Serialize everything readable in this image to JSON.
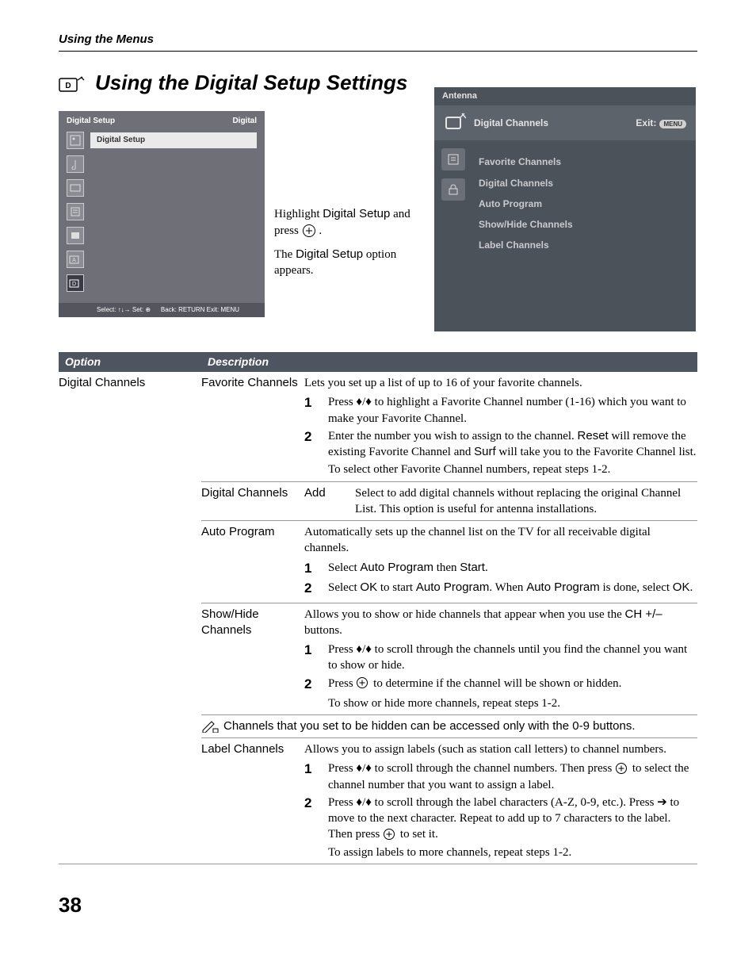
{
  "section_header": "Using the Menus",
  "page_title": "Using the Digital Setup Settings",
  "setup_osd": {
    "title_left": "Digital Setup",
    "title_right": "Digital",
    "highlighted_row": "Digital Setup",
    "footer_left": "Select: ↑↓→  Set: ⊕",
    "footer_right": "Back: RETURN  Exit: MENU"
  },
  "middle_instruction": {
    "p1_a": "Highlight ",
    "p1_b": "Digital Setup",
    "p1_c": " and press ",
    "p1_d": " .",
    "p2_a": "The ",
    "p2_b": "Digital Setup",
    "p2_c": " option appears."
  },
  "antenna_osd": {
    "header": "Antenna",
    "title": "Digital Channels",
    "exit_label": "Exit:",
    "exit_badge": "MENU",
    "items": [
      "Favorite Channels",
      "Digital Channels",
      "Auto Program",
      "Show/Hide Channels",
      "Label Channels"
    ]
  },
  "table_header": {
    "c1": "Option",
    "c2": "Description"
  },
  "option_name": "Digital Channels",
  "favorite": {
    "title": "Favorite Channels",
    "intro": "Lets you set up a list of up to 16 of your favorite channels.",
    "s1": "Press ♦/♦ to highlight a Favorite Channel number (1-16) which you want to make your Favorite Channel.",
    "s2_a": "Enter the number you wish to assign to the channel. ",
    "s2_b": "Reset",
    "s2_c": " will remove the existing Favorite Channel and ",
    "s2_d": "Surf",
    "s2_e": " will take you to the Favorite Channel list.",
    "s_after": "To select other Favorite Channel numbers, repeat steps 1-2."
  },
  "digital": {
    "title": "Digital Channels",
    "add_label": "Add",
    "add_desc": "Select to add digital channels without replacing the original Channel List. This option is useful for antenna installations."
  },
  "auto": {
    "title": "Auto Program",
    "intro": "Automatically sets up the channel list on the TV for all receivable digital channels.",
    "s1_a": "Select ",
    "s1_b": "Auto Program",
    "s1_c": " then ",
    "s1_d": "Start",
    "s1_e": ".",
    "s2_a": "Select ",
    "s2_b": "OK",
    "s2_c": " to start ",
    "s2_d": "Auto Program",
    "s2_e": ". When ",
    "s2_f": "Auto Program",
    "s2_g": " is done, select ",
    "s2_h": "OK",
    "s2_i": "."
  },
  "showhide": {
    "title": "Show/Hide Channels",
    "intro_a": "Allows you to show or hide channels that appear when you use the ",
    "intro_b": "CH +/–",
    "intro_c": " buttons.",
    "s1": "Press ♦/♦ to scroll through the channels until you find the channel you want to show or hide.",
    "s2_a": "Press ",
    "s2_b": " to determine if the channel will be shown or hidden.",
    "after": "To show or hide more channels, repeat steps 1-2."
  },
  "note": "Channels that you set to be hidden can be accessed only with the 0-9 buttons.",
  "label": {
    "title": "Label Channels",
    "intro": "Allows you to assign labels (such as station call letters) to channel numbers.",
    "s1_a": "Press ♦/♦ to scroll through the channel numbers. Then press ",
    "s1_b": " to select the channel number that you want to assign a label.",
    "s2_a": "Press ♦/♦ to scroll through the label characters (A-Z, 0-9, etc.). Press ➔ to move to the next character. Repeat to add up to 7 characters to the label. Then press ",
    "s2_b": " to set it.",
    "after": "To assign labels to more channels, repeat steps 1-2."
  },
  "page_number": "38"
}
